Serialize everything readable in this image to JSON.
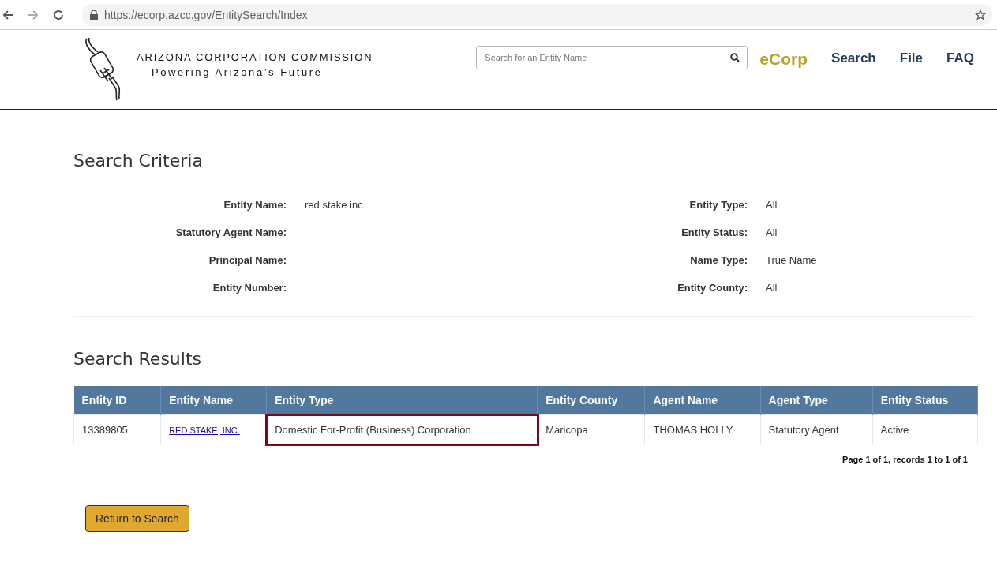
{
  "browser": {
    "url": "https://ecorp.azcc.gov/EntitySearch/Index"
  },
  "header": {
    "logo_title": "ARIZONA CORPORATION COMMISSION",
    "logo_tagline": "Powering Arizona’s Future",
    "search": {
      "placeholder": "Search for an Entity Name"
    },
    "brand": "eCorp",
    "nav": [
      "Search",
      "File",
      "FAQ"
    ]
  },
  "criteria": {
    "title": "Search Criteria",
    "left": [
      {
        "label": "Entity Name:",
        "value": "red stake inc"
      },
      {
        "label": "Statutory Agent Name:"
      },
      {
        "label": "Principal Name:"
      },
      {
        "label": "Entity Number:"
      }
    ],
    "right": [
      {
        "label": "Entity Type:",
        "value": "All"
      },
      {
        "label": "Entity Status:",
        "value": "All"
      },
      {
        "label": "Name Type:",
        "value": "True Name"
      },
      {
        "label": "Entity County:",
        "value": "All"
      }
    ]
  },
  "results": {
    "title": "Search Results",
    "columns": [
      "Entity ID",
      "Entity Name",
      "Entity Type",
      "Entity County",
      "Agent Name",
      "Agent Type",
      "Entity Status"
    ],
    "rows": [
      {
        "cells": [
          {
            "text": "13389805",
            "kind": "text",
            "highlighted": false
          },
          {
            "text": "RED STAKE, INC.",
            "kind": "link",
            "highlighted": false
          },
          {
            "text": "Domestic For-Profit (Business) Corporation",
            "kind": "text",
            "highlighted": true
          },
          {
            "text": "Maricopa",
            "kind": "text",
            "highlighted": false
          },
          {
            "text": "THOMAS HOLLY",
            "kind": "text",
            "highlighted": false
          },
          {
            "text": "Statutory Agent",
            "kind": "text",
            "highlighted": false
          },
          {
            "text": "Active",
            "kind": "text",
            "highlighted": false
          }
        ]
      }
    ],
    "pager": "Page 1 of 1, records 1 to 1 of 1"
  },
  "return_button": "Return to Search"
}
